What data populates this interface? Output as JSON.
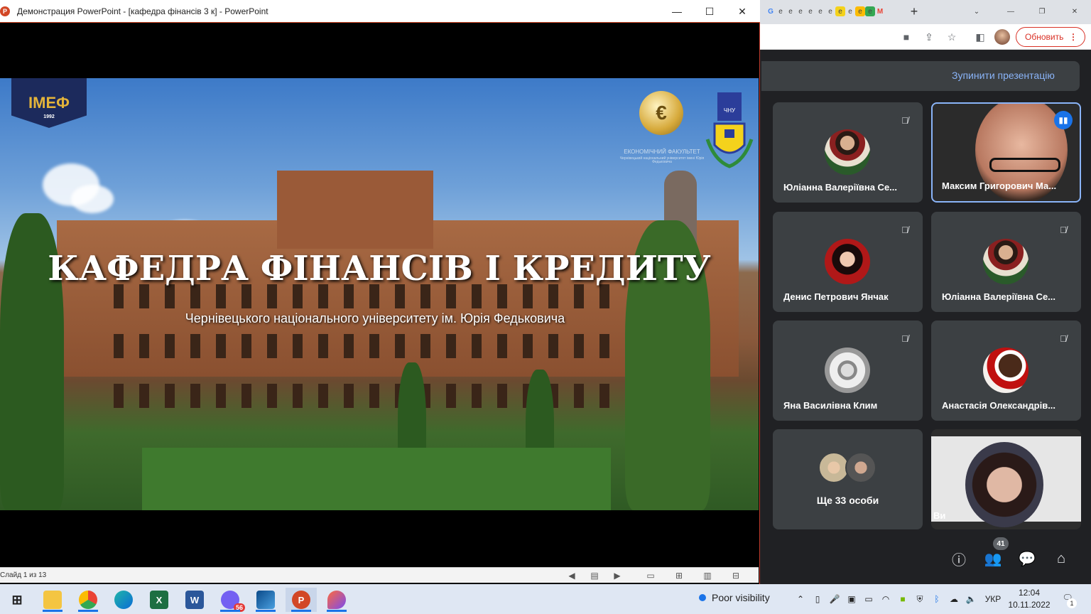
{
  "powerpoint": {
    "app_icon": "P",
    "title": "Демонстрация PowerPoint - [кафедра фінансів 3 к] - PowerPoint",
    "minimize": "—",
    "maximize": "☐",
    "close": "✕",
    "slide": {
      "title": "КАФЕДРА ФІНАНСІВ І КРЕДИТУ",
      "subtitle": "Чернівецького національного університету ім. Юрія Федьковича",
      "logo_left_text": "ІМЕФ",
      "logo_left_year": "1992",
      "econ_logo_text": "ЕКОНОМІЧНИЙ ФАКУЛЬТЕТ",
      "econ_logo_subtext": "Чернівецький національний університет імені Юрія Федьковича",
      "chnu_text": "ЧНУ"
    },
    "status": {
      "slide_counter": "Слайд 1 из 13"
    }
  },
  "chrome": {
    "new_tab": "+",
    "update_button": "Обновить",
    "tab_favicons": [
      "G",
      "e",
      "e",
      "e",
      "e",
      "e",
      "e",
      "e",
      "e",
      "e",
      "e",
      "M"
    ]
  },
  "meet": {
    "stop_presentation": "Зупинити презентацію",
    "participants": [
      {
        "name": "Юліанна Валеріївна Се...",
        "muted": true,
        "avatar": "rose-avatar"
      },
      {
        "name": "Максим Григорович Ма...",
        "muted": false,
        "speaking": true,
        "video": true
      },
      {
        "name": "Денис Петрович Янчак",
        "muted": true,
        "avatar": "anime-avatar"
      },
      {
        "name": "Юліанна Валеріївна Се...",
        "muted": true,
        "avatar": "rose-avatar"
      },
      {
        "name": "Яна Василівна Клим",
        "muted": true,
        "avatar": "bw-avatar"
      },
      {
        "name": "Анастасія Олександрів...",
        "muted": true,
        "avatar": "flower-avatar"
      }
    ],
    "more_people": "Ще 33 особи",
    "self_label": "Ви",
    "people_count": "41"
  },
  "taskbar": {
    "weather": "Poor visibility",
    "language": "УКР",
    "time": "12:04",
    "date": "10.11.2022",
    "notifications": "1",
    "viber_badge": "56"
  }
}
